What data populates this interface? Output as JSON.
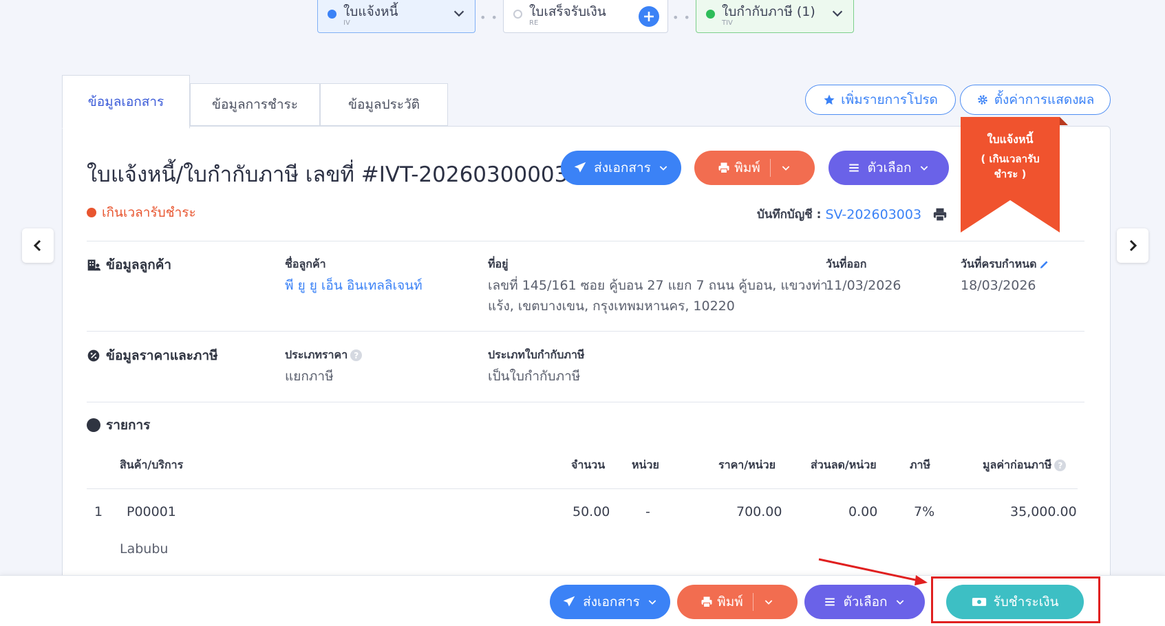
{
  "workflow": {
    "invoice": {
      "label": "ใบแจ้งหนี้",
      "code": "IV"
    },
    "receipt": {
      "label": "ใบเสร็จรับเงิน",
      "code": "RE"
    },
    "tax_invoice": {
      "label": "ใบกำกับภาษี (1)",
      "code": "TIV"
    }
  },
  "tabs": [
    "ข้อมูลเอกสาร",
    "ข้อมูลการชำระ",
    "ข้อมูลประวัติ"
  ],
  "top_actions": {
    "favorite": "เพิ่มรายการโปรด",
    "display_settings": "ตั้งค่าการแสดงผล"
  },
  "document": {
    "title": "ใบแจ้งหนี้/ใบกำกับภาษี เลขที่ #IVT-20260300003",
    "status": "เกินเวลารับชำระ",
    "account_label": "บันทึกบัญชี :",
    "account_value": "SV-202603003"
  },
  "header_buttons": {
    "send": "ส่งเอกสาร",
    "print": "พิมพ์",
    "options": "ตัวเลือก"
  },
  "ribbon": {
    "line1": "ใบแจ้งหนี้",
    "line2": "( เกินเวลารับ",
    "line3": "ชำระ )"
  },
  "customer": {
    "section": "ข้อมูลลูกค้า",
    "name_label": "ชื่อลูกค้า",
    "name": "พี ยู ยู เอ็น อินเทลลิเจนท์",
    "address_label": "ที่อยู่",
    "address_line1": "เลขที่ 145/161 ซอย คู้บอน 27 แยก 7 ถนน คู้บอน, แขวงท่า",
    "address_line2": "แร้ง, เขตบางเขน, กรุงเทพมหานคร, 10220",
    "issue_label": "วันที่ออก",
    "issue_date": "11/03/2026",
    "due_label": "วันที่ครบกำหนด",
    "due_date": "18/03/2026"
  },
  "pricing": {
    "section": "ข้อมูลราคาและภาษี",
    "price_type_label": "ประเภทราคา",
    "price_type": "แยกภาษี",
    "tax_invoice_type_label": "ประเภทใบกำกับภาษี",
    "tax_invoice_type": "เป็นใบกำกับภาษี"
  },
  "items": {
    "section": "รายการ",
    "headers": {
      "product": "สินค้า/บริการ",
      "qty": "จำนวน",
      "unit": "หน่วย",
      "price": "ราคา/หน่วย",
      "discount": "ส่วนลด/หน่วย",
      "tax": "ภาษี",
      "pretax": "มูลค่าก่อนภาษี"
    },
    "rows": [
      {
        "no": "1",
        "code": "P00001",
        "name": "Labubu",
        "qty": "50.00",
        "unit": "-",
        "price": "700.00",
        "discount": "0.00",
        "tax": "7%",
        "pretax": "35,000.00"
      }
    ]
  },
  "bottom_buttons": {
    "send": "ส่งเอกสาร",
    "print": "พิมพ์",
    "options": "ตัวเลือก",
    "receive_payment": "รับชำระเงิน"
  },
  "colors": {
    "send": "#3b82f6",
    "print": "#f26d50",
    "options": "#6a62e8",
    "receive": "#3dbfc4",
    "overdue": "#f0532e",
    "highlight": "#e02020"
  }
}
